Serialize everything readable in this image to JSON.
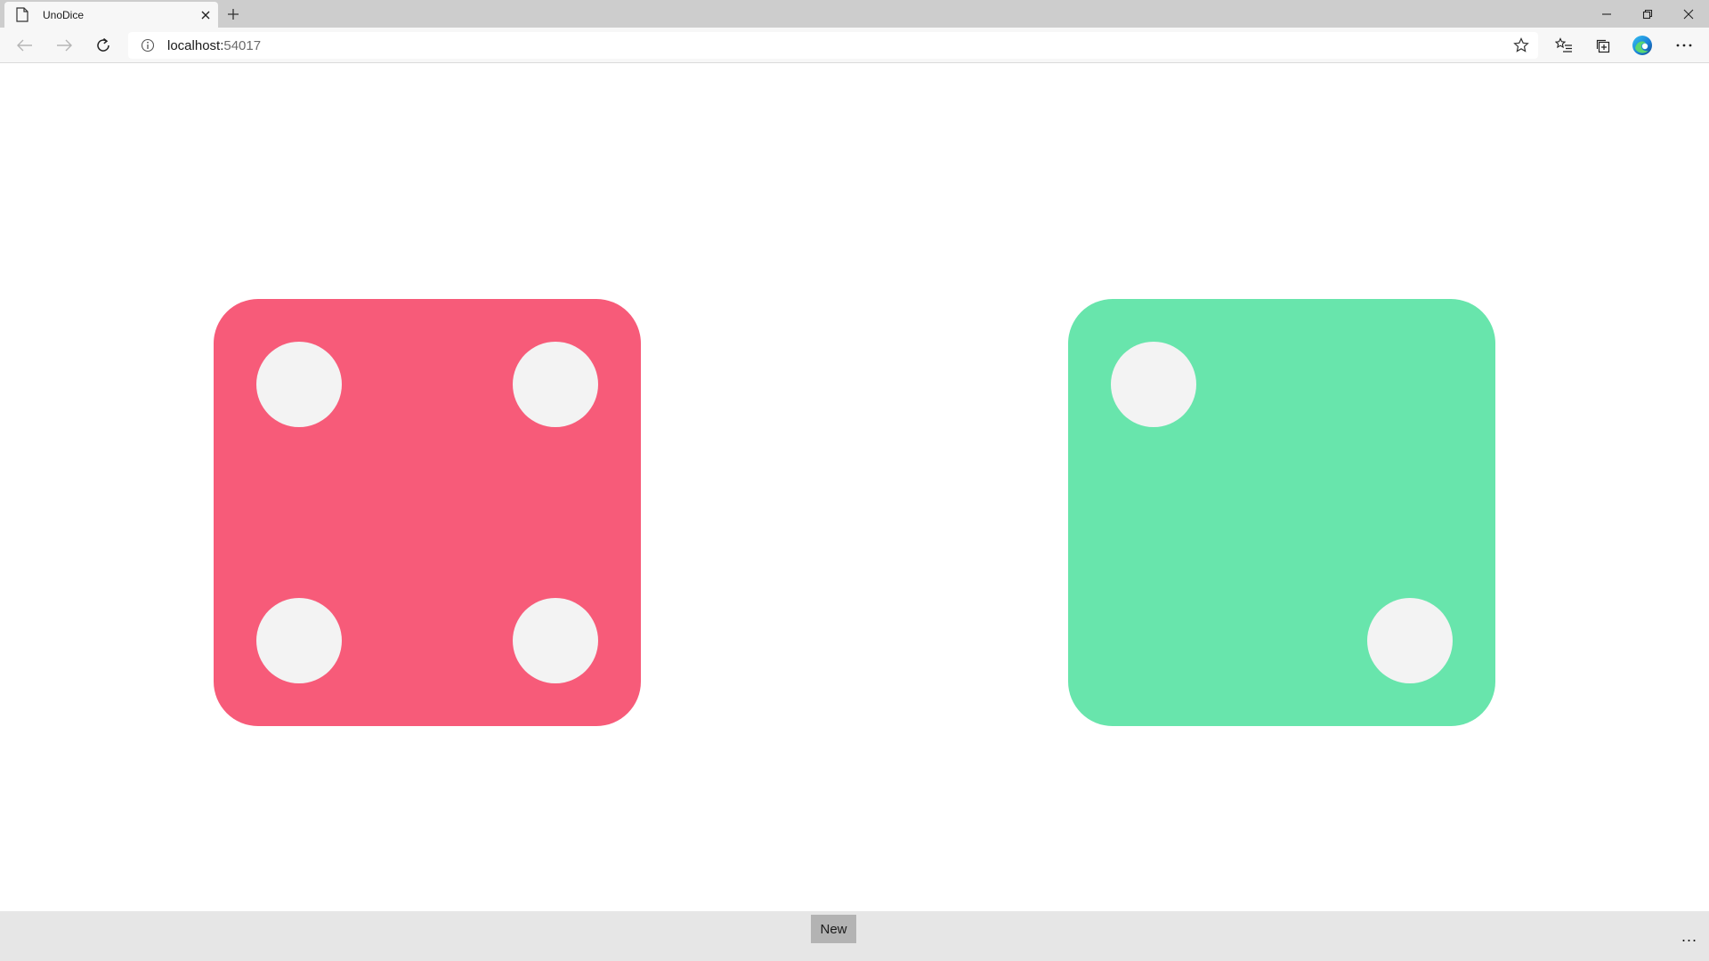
{
  "browser": {
    "tab": {
      "title": "UnoDice"
    },
    "address": {
      "host": "localhost:",
      "port": "54017"
    }
  },
  "dice": [
    {
      "value": 4,
      "color": "#f75b79"
    },
    {
      "value": 2,
      "color": "#68e5ac"
    }
  ],
  "pip_color": "#f3f3f3",
  "command_bar": {
    "new_label": "New",
    "more_label": "..."
  }
}
